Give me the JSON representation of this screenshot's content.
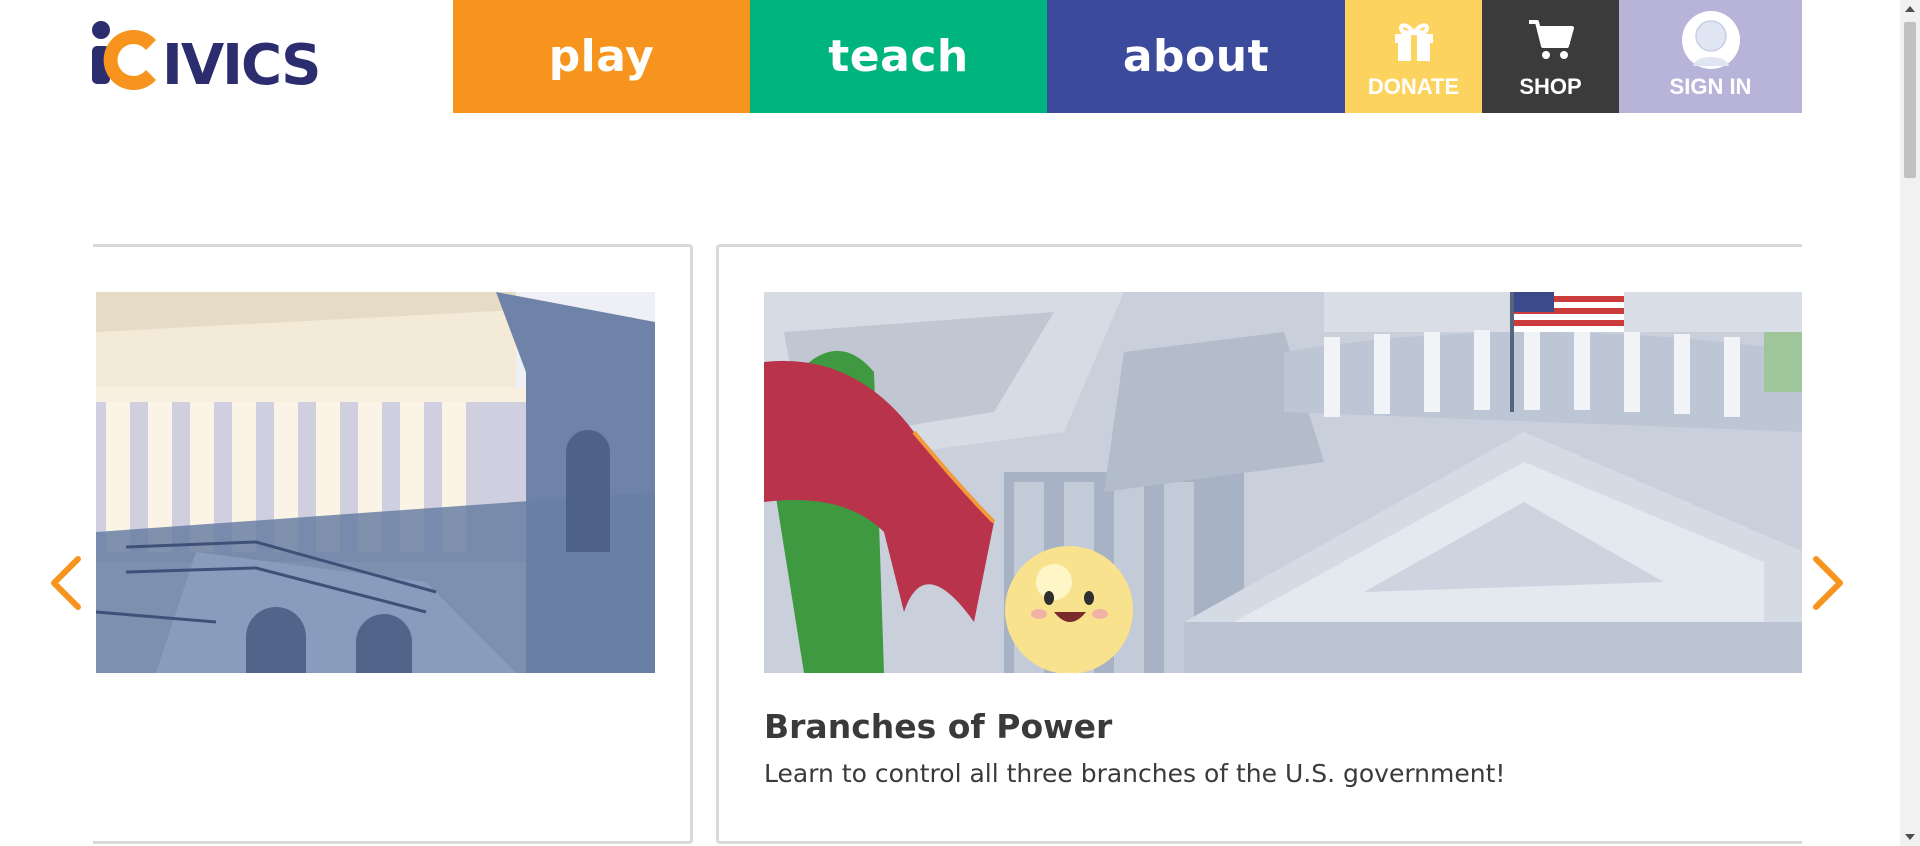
{
  "logo": {
    "text": "iCivics"
  },
  "nav": {
    "play": "play",
    "teach": "teach",
    "about": "about",
    "donate": "DONATE",
    "shop": "SHOP",
    "sign_in": "SIGN IN"
  },
  "colors": {
    "play": "#f7941e",
    "teach": "#00b47e",
    "about": "#3c4a9b",
    "donate": "#fcd35f",
    "shop": "#3b3b3b",
    "sign_in": "#b8b3d9",
    "logo_navy": "#2b2d6e",
    "logo_orange": "#f7941e",
    "arrow": "#f7941e"
  },
  "icons": {
    "donate": "gift-icon",
    "shop": "cart-icon",
    "sign_in": "avatar-icon",
    "prev": "chevron-left-icon",
    "next": "chevron-right-icon"
  },
  "carousel": {
    "current": {
      "title": "Branches of Power",
      "description": "Learn to control all three branches of the U.S. government!"
    }
  }
}
